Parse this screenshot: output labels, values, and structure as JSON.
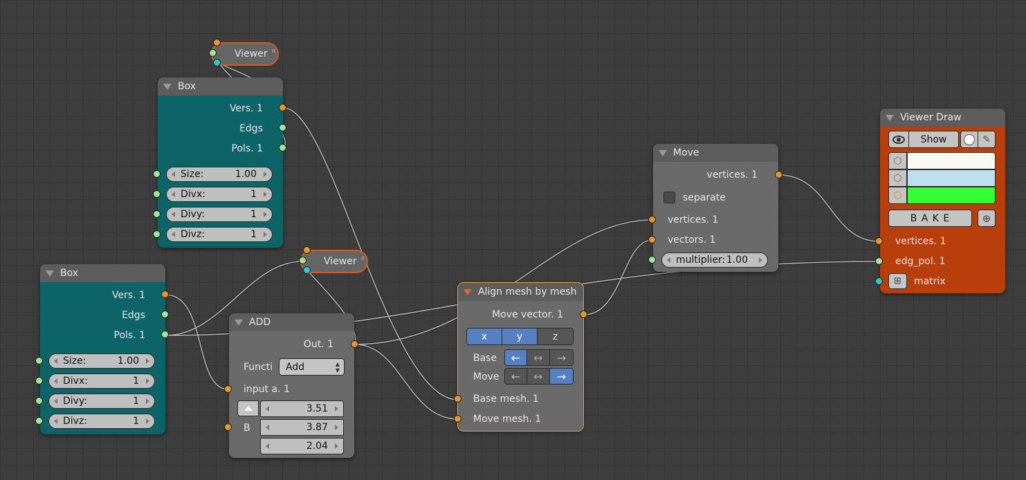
{
  "viewer_top": {
    "label": "Viewer"
  },
  "viewer_mid": {
    "label": "Viewer"
  },
  "box_top": {
    "title": "Box",
    "outputs": [
      "Vers. 1",
      "Edgs",
      "Pols. 1"
    ],
    "size": {
      "label": "Size:",
      "value": "1.00"
    },
    "divx": {
      "label": "Divx:",
      "value": "1"
    },
    "divy": {
      "label": "Divy:",
      "value": "1"
    },
    "divz": {
      "label": "Divz:",
      "value": "1"
    }
  },
  "box_bottom": {
    "title": "Box",
    "outputs": [
      "Vers. 1",
      "Edgs",
      "Pols. 1"
    ],
    "size": {
      "label": "Size:",
      "value": "1.00"
    },
    "divx": {
      "label": "Divx:",
      "value": "1"
    },
    "divy": {
      "label": "Divy:",
      "value": "1"
    },
    "divz": {
      "label": "Divz:",
      "value": "1"
    }
  },
  "add": {
    "title": "ADD",
    "out": "Out. 1",
    "func_label": "Functi",
    "func_value": "Add",
    "input_a": "input a. 1",
    "b_label": "B",
    "vector": [
      "3.51",
      "3.87",
      "2.04"
    ]
  },
  "align": {
    "title": "Align mesh by mesh",
    "move_vector": "Move vector. 1",
    "axes": [
      "x",
      "y",
      "z"
    ],
    "base_label": "Base",
    "move_label": "Move",
    "base_mesh": "Base mesh. 1",
    "move_mesh": "Move mesh. 1"
  },
  "move": {
    "title": "Move",
    "out": "vertices. 1",
    "separate": "separate",
    "in_vertices": "vertices. 1",
    "in_vectors": "vectors. 1",
    "multiplier": {
      "label": "multiplier:",
      "value": "1.00"
    }
  },
  "viewer_draw": {
    "title": "Viewer Draw",
    "show": "Show",
    "bake": "B A K E",
    "colors": [
      "#f9f9ef",
      "#bde0f0",
      "#33ff33"
    ],
    "in_vertices": "vertices. 1",
    "in_edgpol": "edg_pol. 1",
    "in_matrix": "matrix"
  }
}
